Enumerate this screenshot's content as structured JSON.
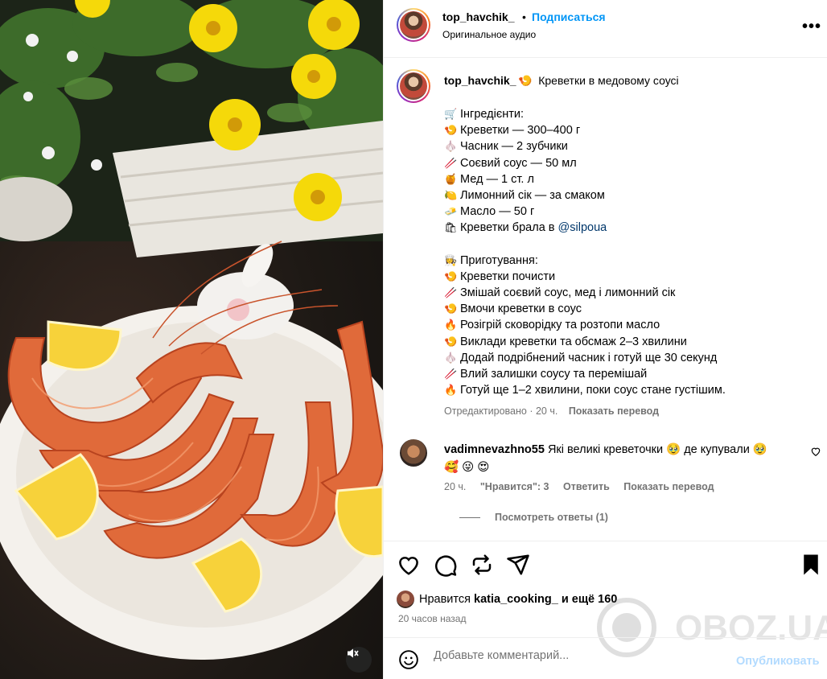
{
  "post": {
    "username": "top_havchik_",
    "dot": "•",
    "follow_label": "Подписаться",
    "audio": "Оригинальное аудио",
    "more_label": "•••"
  },
  "caption": {
    "username": "top_havchik_",
    "title_emoji": "🍤",
    "title": "Креветки в медовому соусі",
    "lines": [
      {
        "emoji": "🛒",
        "text": "Інгредієнти:"
      },
      {
        "emoji": "🍤",
        "text": "Креветки — 300–400 г"
      },
      {
        "emoji": "🧄",
        "text": "Часник — 2 зубчики"
      },
      {
        "emoji": "🥢",
        "text": "Соєвий соус — 50 мл"
      },
      {
        "emoji": "🍯",
        "text": "Мед — 1 ст. л"
      },
      {
        "emoji": "🍋",
        "text": "Лимонний сік — за смаком"
      },
      {
        "emoji": "🧈",
        "text": "Масло — 50 г"
      },
      {
        "emoji": "🛍",
        "text": "Креветки брала в ",
        "mention": "@silpoua"
      },
      {
        "emoji": "",
        "text": ""
      },
      {
        "emoji": "👩‍🍳",
        "text": "Приготування:"
      },
      {
        "emoji": "🍤",
        "text": "Креветки почисти"
      },
      {
        "emoji": "🥢",
        "text": "Змішай соєвий соус, мед і лимонний сік"
      },
      {
        "emoji": "🍤",
        "text": "Вмочи креветки в соус"
      },
      {
        "emoji": "🔥",
        "text": "Розігрій сковорідку та розтопи масло"
      },
      {
        "emoji": "🍤",
        "text": "Виклади креветки та обсмаж 2–3 хвилини"
      },
      {
        "emoji": "🧄",
        "text": "Додай подрібнений часник і готуй ще 30 секунд"
      },
      {
        "emoji": "🥢",
        "text": "Влий залишки соусу та перемішай"
      },
      {
        "emoji": "🔥",
        "text": "Готуй ще 1–2 хвилини, поки соус стане густішим."
      }
    ],
    "edited": "Отредактировано · 20 ч.",
    "translate": "Показать перевод"
  },
  "comment": {
    "username": "vadimnevazhno55",
    "text": "Які великі креветочки 🥹 де купували 🥹",
    "text2": "🥰 😜 😍",
    "age": "20 ч.",
    "likes": "\"Нравится\": 3",
    "reply": "Ответить",
    "translate": "Показать перевод",
    "view_replies": "Посмотреть ответы (1)"
  },
  "likes": {
    "prefix": "Нравится",
    "user": "katia_cooking_",
    "suffix": "и ещё 160"
  },
  "timestamp": "20 часов назад",
  "add_comment": {
    "placeholder": "Добавьте комментарий...",
    "publish": "Опубликовать"
  },
  "watermark": "OBOZ.UA",
  "colors": {
    "accent": "#0095f6",
    "muted": "#737373",
    "publish_disabled": "#b3dbff",
    "mention": "#00376b"
  },
  "icons": [
    "heart-icon",
    "comment-icon",
    "repost-icon",
    "share-icon",
    "bookmark-icon",
    "emoji-icon",
    "mute-icon",
    "more-icon"
  ]
}
